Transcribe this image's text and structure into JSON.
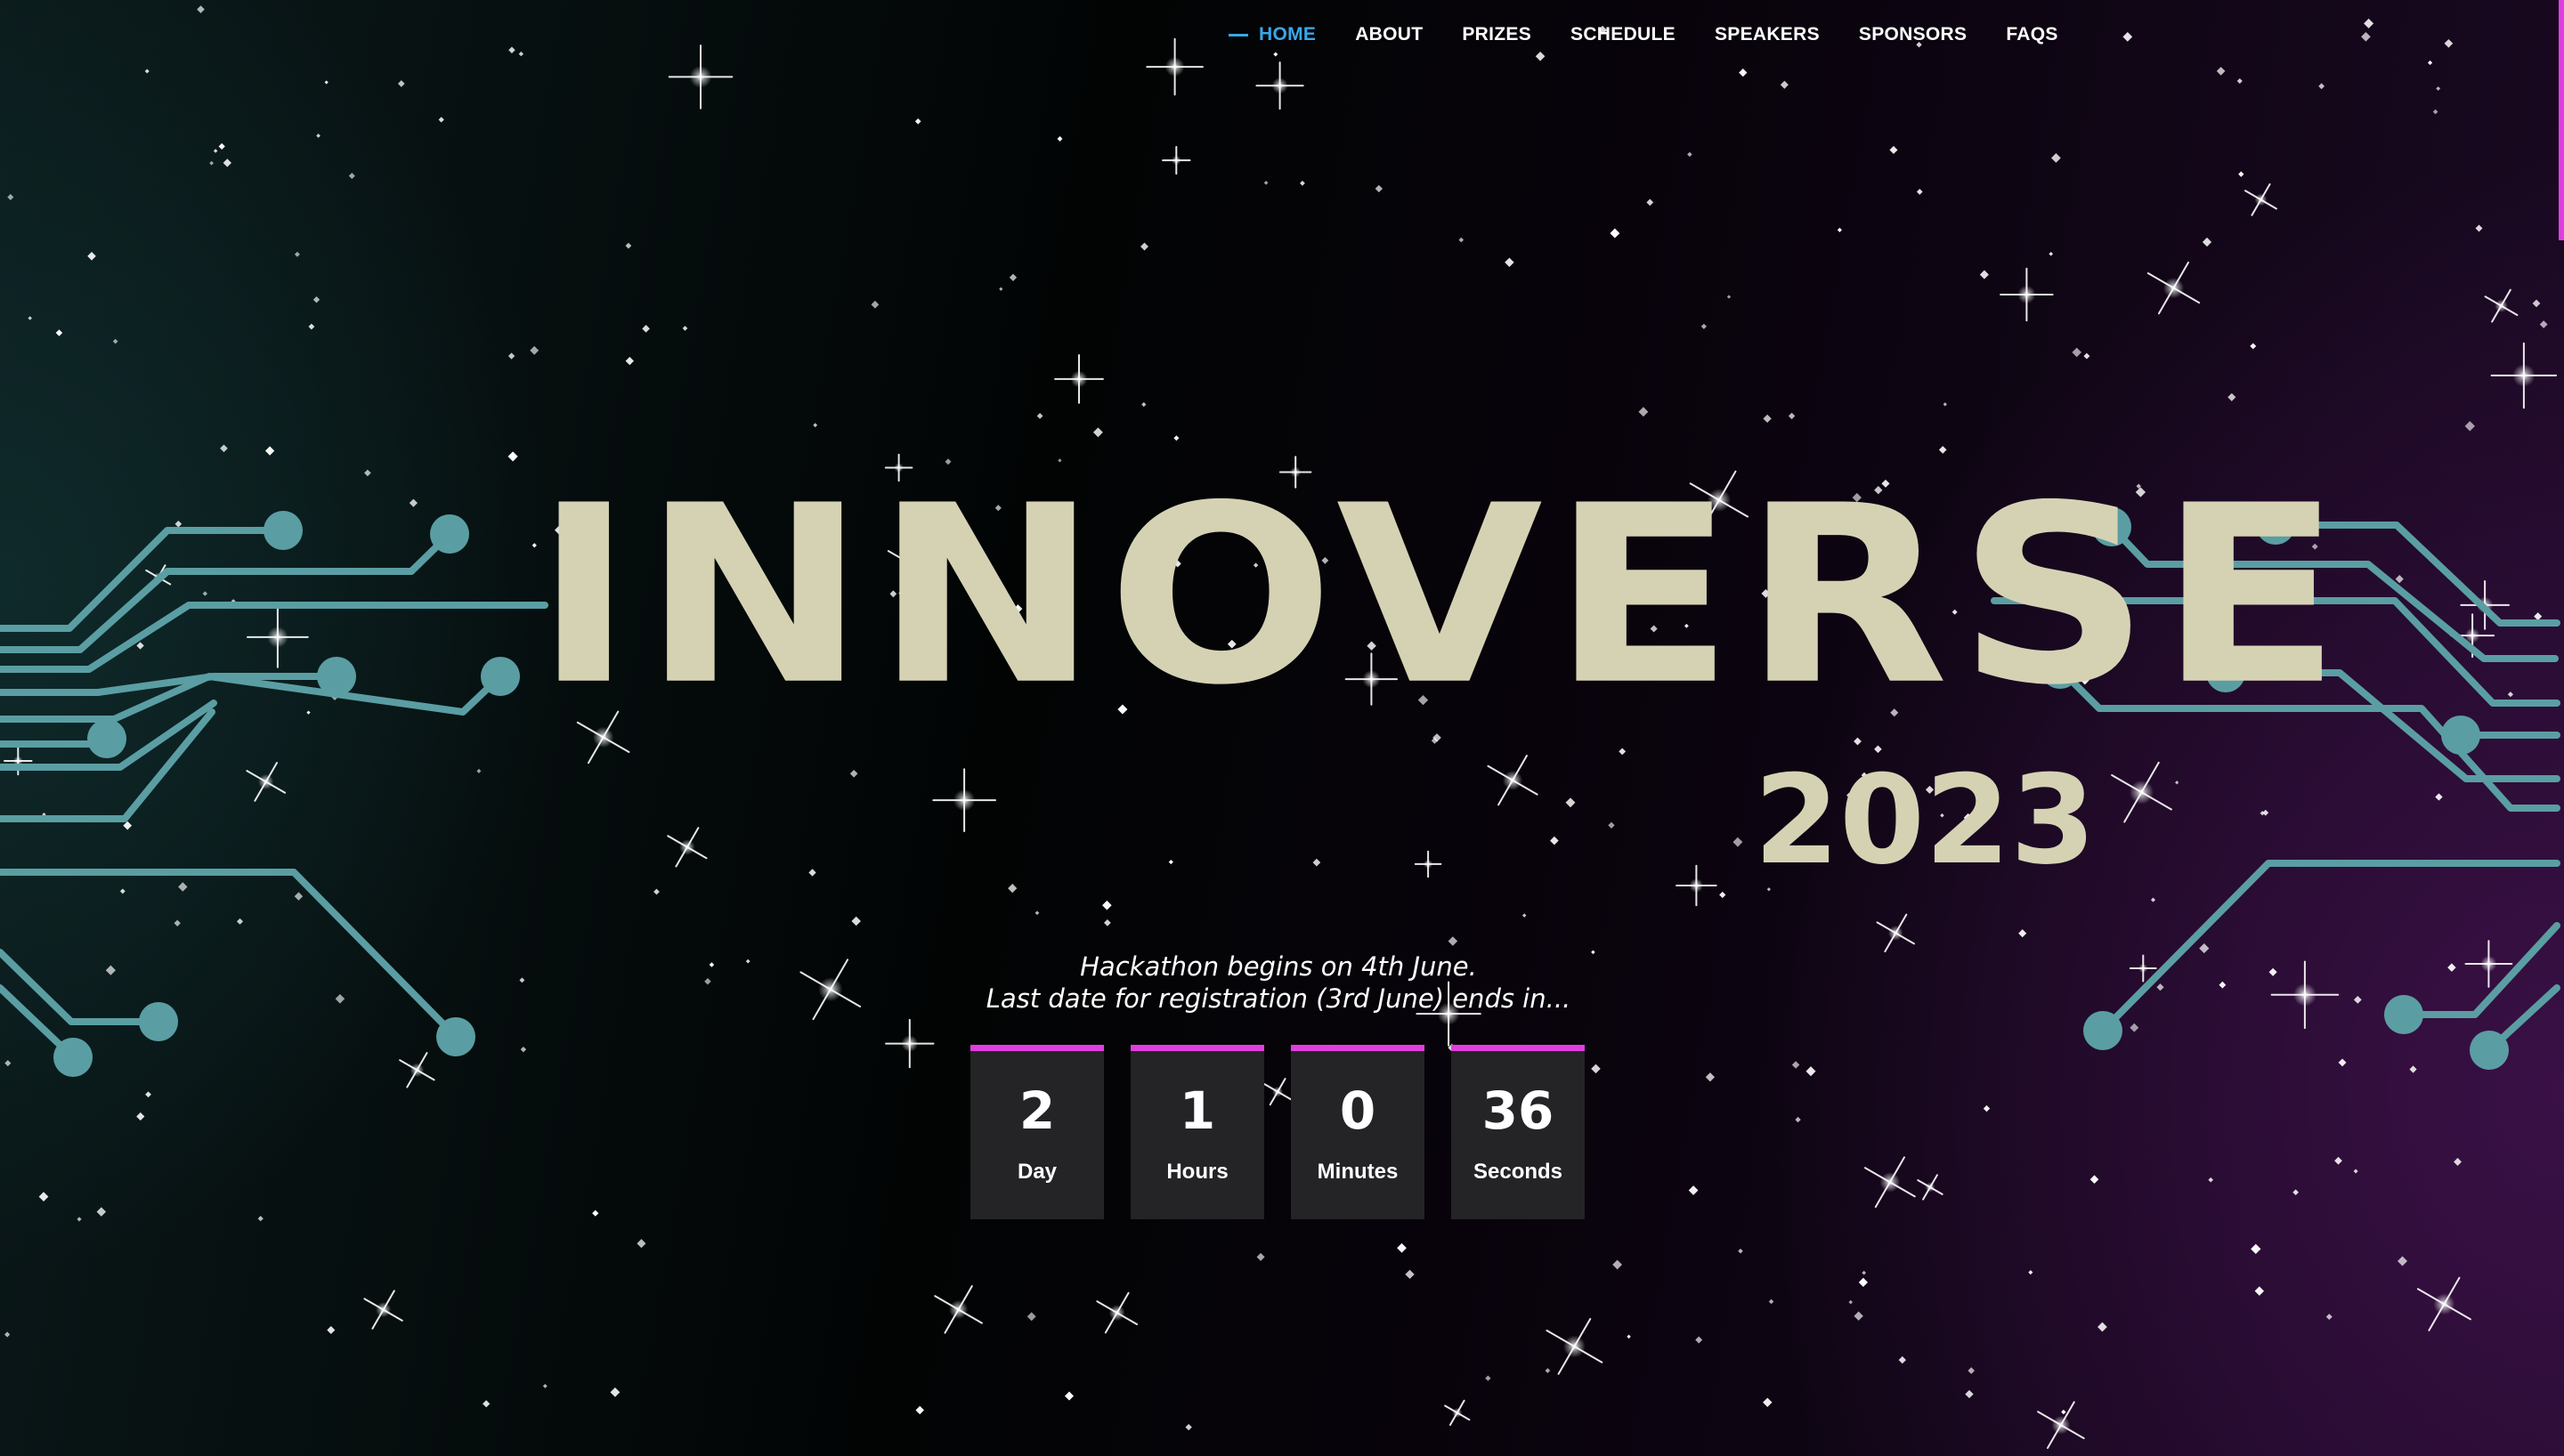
{
  "nav": {
    "items": [
      {
        "label": "HOME",
        "active": true
      },
      {
        "label": "ABOUT",
        "active": false
      },
      {
        "label": "PRIZES",
        "active": false
      },
      {
        "label": "SCHEDULE",
        "active": false
      },
      {
        "label": "SPEAKERS",
        "active": false
      },
      {
        "label": "SPONSORS",
        "active": false
      },
      {
        "label": "FAQS",
        "active": false
      }
    ]
  },
  "hero": {
    "title": "INNOVERSE",
    "year": "2023",
    "tagline_line1": "Hackathon begins on 4th June.",
    "tagline_line2": "Last date for registration (3rd June) ends in..."
  },
  "countdown": [
    {
      "value": "2",
      "label": "Day"
    },
    {
      "value": "1",
      "label": "Hours"
    },
    {
      "value": "0",
      "label": "Minutes"
    },
    {
      "value": "36",
      "label": "Seconds"
    }
  ],
  "colors": {
    "accent_nav": "#3aa7e8",
    "accent_countdown": "#e23de0",
    "title_color": "#d5d2b4",
    "circuit_color": "#5a9ea3"
  },
  "icons": {
    "decor": "star-sparkle-icon",
    "circuit": "circuit-trace-icon"
  }
}
